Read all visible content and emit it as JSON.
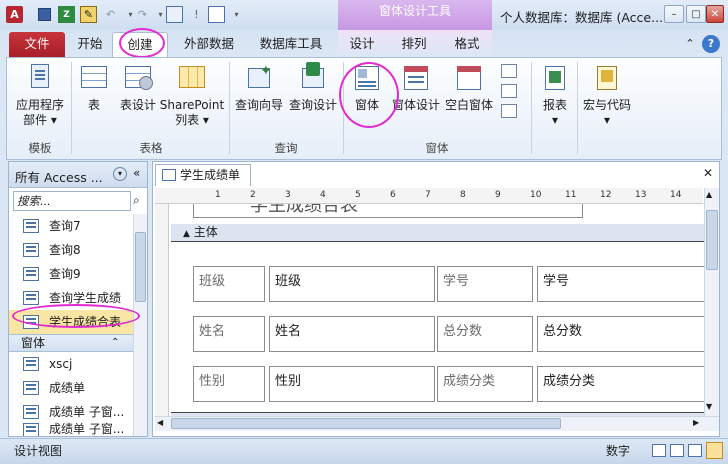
{
  "titlebar": {
    "window_title": "个人数据库：数据库 (Acce...",
    "context_title": "窗体设计工具"
  },
  "tabs": [
    "文件",
    "开始",
    "创建",
    "外部数据",
    "数据库工具",
    "设计",
    "排列",
    "格式"
  ],
  "ribbon": {
    "templates": {
      "btn1": "应用程序",
      "btn1b": "部件 ▾",
      "label": "模板"
    },
    "tables": {
      "btn1": "表",
      "btn2": "表设计",
      "btn3": "SharePoint",
      "btn3b": "列表 ▾",
      "label": "表格"
    },
    "queries": {
      "btn1": "查询向导",
      "btn2": "查询设计",
      "label": "查询"
    },
    "forms": {
      "btn1": "窗体",
      "btn2": "窗体设计",
      "btn3": "空白窗体",
      "label": "窗体"
    },
    "reports": {
      "btn1": "报表",
      "btn1b": "▾"
    },
    "macros": {
      "btn1": "宏与代码",
      "btn1b": "▾"
    }
  },
  "nav": {
    "header": "所有 Access ...",
    "search_placeholder": "搜索...",
    "items": [
      "查询7",
      "查询8",
      "查询9",
      "查询学生成绩",
      "学生成绩合表"
    ],
    "section": "窗体",
    "form_items": [
      "xscj",
      "成绩单",
      "成绩单 子窗...",
      "成绩单 子窗..."
    ]
  },
  "doc": {
    "tab_title": "学生成绩单",
    "header_text": "学生成绩合表",
    "section": "主体",
    "ruler_marks": [
      "1",
      "2",
      "3",
      "4",
      "5",
      "6",
      "7",
      "8",
      "9",
      "10",
      "11",
      "12",
      "13",
      "14"
    ],
    "fields": [
      {
        "label": "班级",
        "value": "班级",
        "label2": "学号",
        "value2": "学号"
      },
      {
        "label": "姓名",
        "value": "姓名",
        "label2": "总分数",
        "value2": "总分数"
      },
      {
        "label": "性别",
        "value": "性别",
        "label2": "成绩分类",
        "value2": "成绩分类"
      }
    ]
  },
  "status": {
    "left": "设计视图",
    "right": "数字"
  },
  "colors": {
    "file_tab": "#b82630",
    "context": "#c797e3",
    "annotation": "#e32bd3"
  }
}
